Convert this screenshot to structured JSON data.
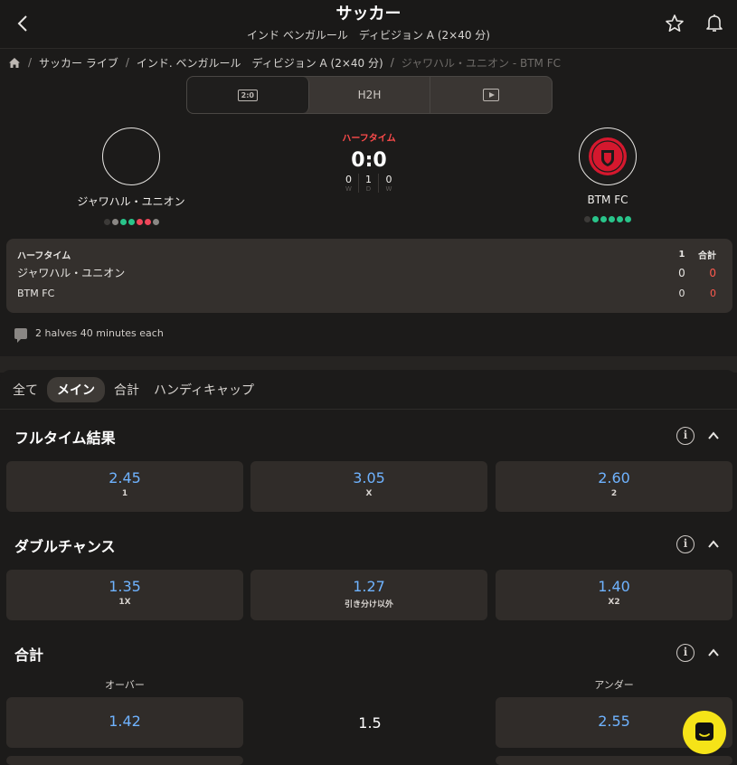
{
  "header": {
    "title": "サッカー",
    "subtitle": "インド ベンガルール　ディビジョン A (2×40 分)"
  },
  "breadcrumb": {
    "items": [
      "サッカー ライブ",
      "インド. ベンガルール　ディビジョン A (2×40 分)"
    ],
    "current": "ジャワハル・ユニオン - BTM FC",
    "separator": "/"
  },
  "segment": {
    "score_icon_text": "2:0",
    "h2h_label": "H2H"
  },
  "match": {
    "status": "ハーフタイム",
    "score": "0:0",
    "stats": [
      {
        "value": "0",
        "label": "W"
      },
      {
        "value": "1",
        "label": "D"
      },
      {
        "value": "0",
        "label": "W"
      }
    ],
    "home": {
      "name": "ジャワハル・ユニオン",
      "form": [
        "#3c3a38",
        "#8a8784",
        "#29c48a",
        "#29c48a",
        "#f0465a",
        "#f0465a",
        "#8a8784"
      ]
    },
    "away": {
      "name": "BTM FC",
      "form": [
        "#3c3a38",
        "#29c48a",
        "#29c48a",
        "#29c48a",
        "#29c48a",
        "#29c48a"
      ]
    },
    "accent_live": "#ff4b4b",
    "away_logo_color": "#d5182e"
  },
  "scoreboard": {
    "period_label": "ハーフタイム",
    "col1_header": "1",
    "col2_header": "合計",
    "rows": [
      {
        "team": "ジャワハル・ユニオン",
        "c1": "0",
        "total": "0"
      },
      {
        "team": "BTM FC",
        "c1": "0",
        "total": "0"
      }
    ]
  },
  "note": "2 halves 40 minutes each",
  "market_tabs": [
    {
      "label": "全て",
      "active": false
    },
    {
      "label": "メイン",
      "active": true
    },
    {
      "label": "合計",
      "active": false
    },
    {
      "label": "ハンディキャップ",
      "active": false
    }
  ],
  "markets": {
    "fulltime": {
      "title": "フルタイム結果",
      "odds": [
        {
          "price": "2.45",
          "label": "1"
        },
        {
          "price": "3.05",
          "label": "X"
        },
        {
          "price": "2.60",
          "label": "2"
        }
      ]
    },
    "double": {
      "title": "ダブルチャンス",
      "odds": [
        {
          "price": "1.35",
          "label": "1X"
        },
        {
          "price": "1.27",
          "label": "引き分け以外"
        },
        {
          "price": "1.40",
          "label": "X2"
        }
      ]
    },
    "total": {
      "title": "合計",
      "over_label": "オーバー",
      "under_label": "アンダー",
      "line": "1.5",
      "over": "1.42",
      "under": "2.55"
    }
  },
  "colors": {
    "odd_price": "#6fb3ff",
    "chat_button": "#f5e318"
  }
}
